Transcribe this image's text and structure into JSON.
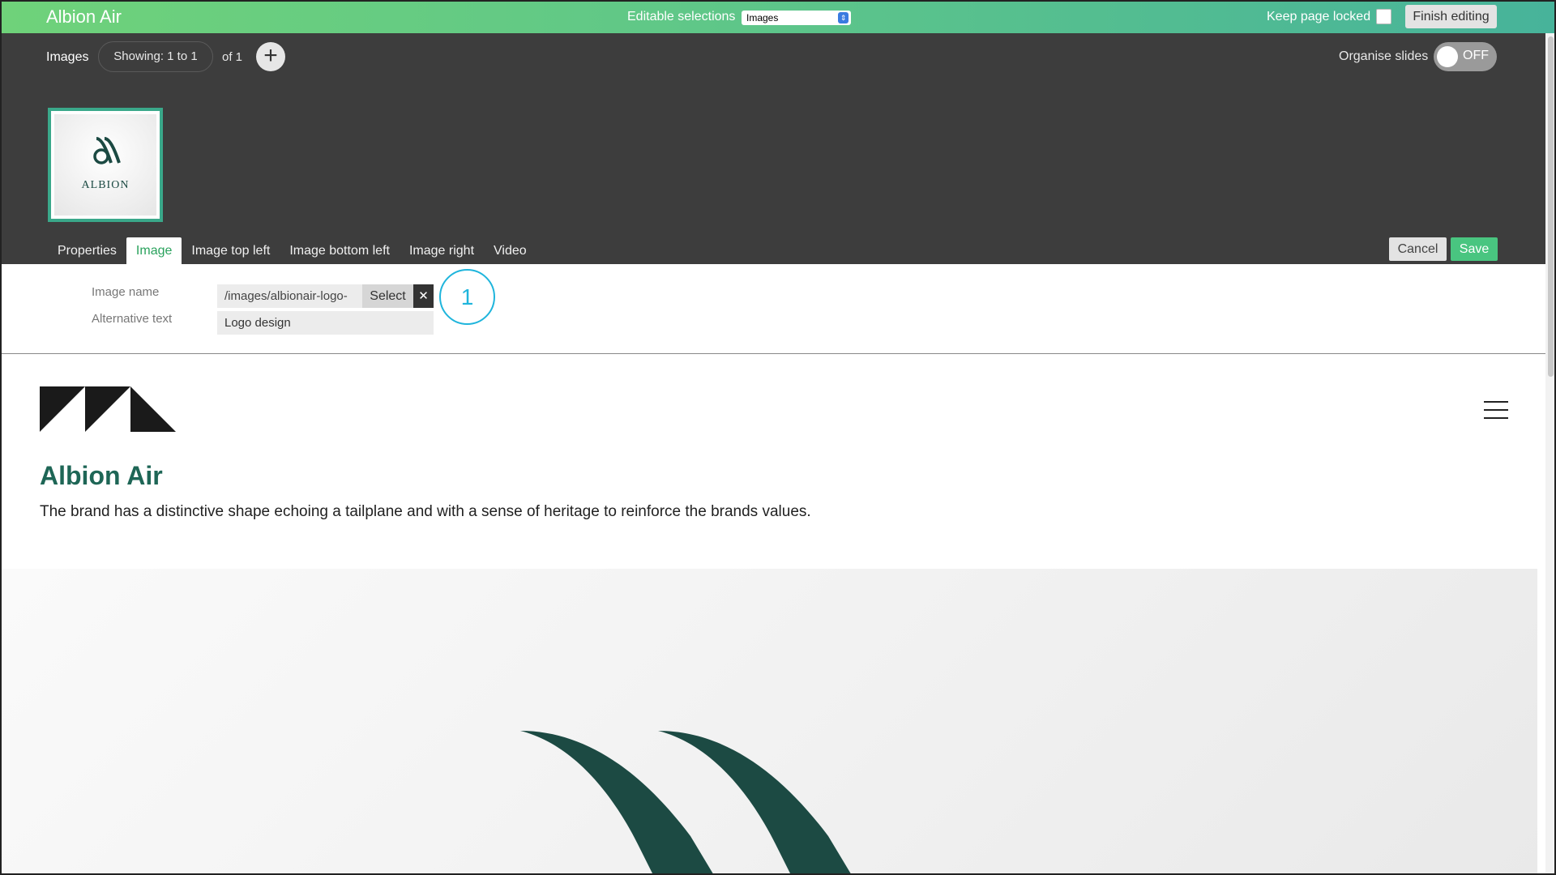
{
  "topbar": {
    "app_title": "Albion Air",
    "editable_selections_label": "Editable selections",
    "editable_selection_value": "Images",
    "keep_locked_label": "Keep page locked",
    "finish_editing_label": "Finish editing"
  },
  "slides": {
    "section_label": "Images",
    "showing_label": "Showing: 1 to 1",
    "of_label": "of 1",
    "add_icon": "plus-icon",
    "organise_label": "Organise slides",
    "organise_state": "OFF",
    "thumbnail_text": "ALBION"
  },
  "tabs": [
    {
      "label": "Properties",
      "active": false
    },
    {
      "label": "Image",
      "active": true
    },
    {
      "label": "Image top left",
      "active": false
    },
    {
      "label": "Image bottom left",
      "active": false
    },
    {
      "label": "Image right",
      "active": false
    },
    {
      "label": "Video",
      "active": false
    }
  ],
  "actions": {
    "cancel_label": "Cancel",
    "save_label": "Save"
  },
  "form": {
    "image_name_label": "Image name",
    "image_name_value": "/images/albionair-logo-",
    "select_label": "Select",
    "clear_label": "✕",
    "alt_text_label": "Alternative text",
    "alt_text_value": "Logo design",
    "callout_number": "1"
  },
  "preview": {
    "heading": "Albion Air",
    "description": "The brand has a distinctive shape echoing a tailplane and with a sense of heritage to reinforce the brands values."
  },
  "colors": {
    "accent_green": "#49c580",
    "heading_teal": "#1e6656",
    "brand_dark_green": "#1c4a43",
    "callout_cyan": "#1fb5dc",
    "panel_dark": "#3d3d3d"
  }
}
